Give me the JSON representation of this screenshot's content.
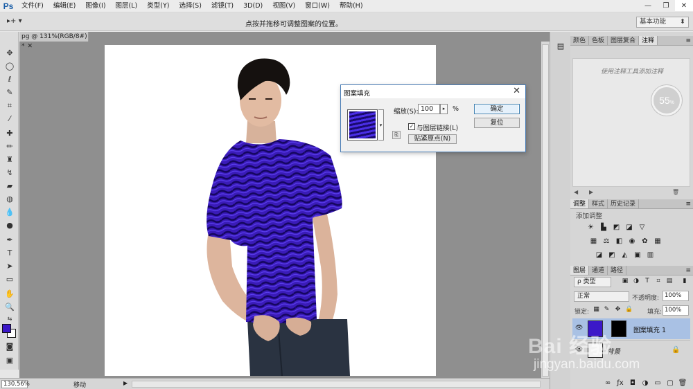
{
  "app": {
    "logo": "Ps",
    "menu": [
      "文件(F)",
      "编辑(E)",
      "图像(I)",
      "图层(L)",
      "类型(Y)",
      "选择(S)",
      "滤镜(T)",
      "3D(D)",
      "视图(V)",
      "窗口(W)",
      "帮助(H)"
    ]
  },
  "options_bar": {
    "tool_preset": "▸+ ▾",
    "hint": "点按并拖移可调整图案的位置。",
    "workspace": "基本功能"
  },
  "document": {
    "tab_label": "pg @ 131%(RGB/8#) *"
  },
  "status": {
    "zoom": "130.56%",
    "info": "移动"
  },
  "panels": {
    "top_tabs": [
      "颜色",
      "色板",
      "图层复合",
      "注释"
    ],
    "notes_hint": "使用注释工具添加注释",
    "notes_badge": "55",
    "notes_badge_unit": "%",
    "mid_tabs": [
      "调整",
      "样式",
      "历史记录"
    ],
    "adjustments_label": "添加调整",
    "layers_tabs": [
      "图层",
      "通道",
      "路径"
    ],
    "layer_kind": "ρ 类型",
    "blend_mode": "正常",
    "opacity_label": "不透明度:",
    "opacity_value": "100%",
    "lock_label": "锁定:",
    "fill_label": "填充:",
    "fill_value": "100%",
    "layers": [
      {
        "name": "图案填充 1",
        "selected": true
      },
      {
        "name": "背景",
        "selected": false
      }
    ]
  },
  "dialog": {
    "title": "图案填充",
    "scale_label": "缩放(S):",
    "scale_value": "100",
    "scale_unit": "%",
    "link_label": "与图层链接(L)",
    "link_checked": true,
    "snap_origin": "贴紧原点(N)",
    "ok": "确定",
    "reset": "复位"
  },
  "watermark": {
    "logo": "Bai 经验",
    "url": "jingyan.baidu.com"
  },
  "colors": {
    "foreground": "#3b18c8",
    "background": "#ffffff",
    "selected_layer": "#a9c1e4",
    "pattern_dark": "#1a0a6e",
    "pattern_light": "#4a2ee6"
  }
}
